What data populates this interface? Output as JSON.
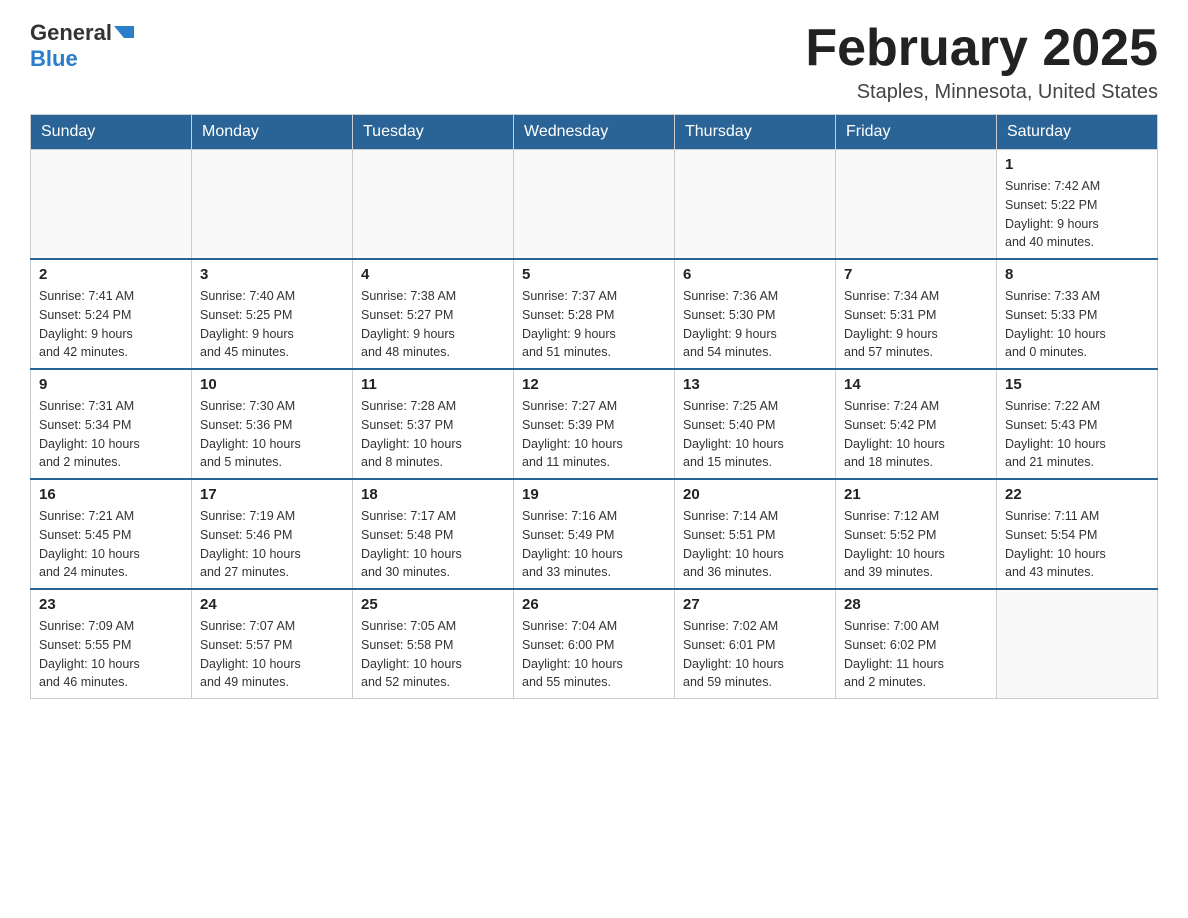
{
  "header": {
    "logo_general": "General",
    "logo_blue": "Blue",
    "title": "February 2025",
    "location": "Staples, Minnesota, United States"
  },
  "days_of_week": [
    "Sunday",
    "Monday",
    "Tuesday",
    "Wednesday",
    "Thursday",
    "Friday",
    "Saturday"
  ],
  "weeks": [
    [
      {
        "day": "",
        "info": ""
      },
      {
        "day": "",
        "info": ""
      },
      {
        "day": "",
        "info": ""
      },
      {
        "day": "",
        "info": ""
      },
      {
        "day": "",
        "info": ""
      },
      {
        "day": "",
        "info": ""
      },
      {
        "day": "1",
        "info": "Sunrise: 7:42 AM\nSunset: 5:22 PM\nDaylight: 9 hours\nand 40 minutes."
      }
    ],
    [
      {
        "day": "2",
        "info": "Sunrise: 7:41 AM\nSunset: 5:24 PM\nDaylight: 9 hours\nand 42 minutes."
      },
      {
        "day": "3",
        "info": "Sunrise: 7:40 AM\nSunset: 5:25 PM\nDaylight: 9 hours\nand 45 minutes."
      },
      {
        "day": "4",
        "info": "Sunrise: 7:38 AM\nSunset: 5:27 PM\nDaylight: 9 hours\nand 48 minutes."
      },
      {
        "day": "5",
        "info": "Sunrise: 7:37 AM\nSunset: 5:28 PM\nDaylight: 9 hours\nand 51 minutes."
      },
      {
        "day": "6",
        "info": "Sunrise: 7:36 AM\nSunset: 5:30 PM\nDaylight: 9 hours\nand 54 minutes."
      },
      {
        "day": "7",
        "info": "Sunrise: 7:34 AM\nSunset: 5:31 PM\nDaylight: 9 hours\nand 57 minutes."
      },
      {
        "day": "8",
        "info": "Sunrise: 7:33 AM\nSunset: 5:33 PM\nDaylight: 10 hours\nand 0 minutes."
      }
    ],
    [
      {
        "day": "9",
        "info": "Sunrise: 7:31 AM\nSunset: 5:34 PM\nDaylight: 10 hours\nand 2 minutes."
      },
      {
        "day": "10",
        "info": "Sunrise: 7:30 AM\nSunset: 5:36 PM\nDaylight: 10 hours\nand 5 minutes."
      },
      {
        "day": "11",
        "info": "Sunrise: 7:28 AM\nSunset: 5:37 PM\nDaylight: 10 hours\nand 8 minutes."
      },
      {
        "day": "12",
        "info": "Sunrise: 7:27 AM\nSunset: 5:39 PM\nDaylight: 10 hours\nand 11 minutes."
      },
      {
        "day": "13",
        "info": "Sunrise: 7:25 AM\nSunset: 5:40 PM\nDaylight: 10 hours\nand 15 minutes."
      },
      {
        "day": "14",
        "info": "Sunrise: 7:24 AM\nSunset: 5:42 PM\nDaylight: 10 hours\nand 18 minutes."
      },
      {
        "day": "15",
        "info": "Sunrise: 7:22 AM\nSunset: 5:43 PM\nDaylight: 10 hours\nand 21 minutes."
      }
    ],
    [
      {
        "day": "16",
        "info": "Sunrise: 7:21 AM\nSunset: 5:45 PM\nDaylight: 10 hours\nand 24 minutes."
      },
      {
        "day": "17",
        "info": "Sunrise: 7:19 AM\nSunset: 5:46 PM\nDaylight: 10 hours\nand 27 minutes."
      },
      {
        "day": "18",
        "info": "Sunrise: 7:17 AM\nSunset: 5:48 PM\nDaylight: 10 hours\nand 30 minutes."
      },
      {
        "day": "19",
        "info": "Sunrise: 7:16 AM\nSunset: 5:49 PM\nDaylight: 10 hours\nand 33 minutes."
      },
      {
        "day": "20",
        "info": "Sunrise: 7:14 AM\nSunset: 5:51 PM\nDaylight: 10 hours\nand 36 minutes."
      },
      {
        "day": "21",
        "info": "Sunrise: 7:12 AM\nSunset: 5:52 PM\nDaylight: 10 hours\nand 39 minutes."
      },
      {
        "day": "22",
        "info": "Sunrise: 7:11 AM\nSunset: 5:54 PM\nDaylight: 10 hours\nand 43 minutes."
      }
    ],
    [
      {
        "day": "23",
        "info": "Sunrise: 7:09 AM\nSunset: 5:55 PM\nDaylight: 10 hours\nand 46 minutes."
      },
      {
        "day": "24",
        "info": "Sunrise: 7:07 AM\nSunset: 5:57 PM\nDaylight: 10 hours\nand 49 minutes."
      },
      {
        "day": "25",
        "info": "Sunrise: 7:05 AM\nSunset: 5:58 PM\nDaylight: 10 hours\nand 52 minutes."
      },
      {
        "day": "26",
        "info": "Sunrise: 7:04 AM\nSunset: 6:00 PM\nDaylight: 10 hours\nand 55 minutes."
      },
      {
        "day": "27",
        "info": "Sunrise: 7:02 AM\nSunset: 6:01 PM\nDaylight: 10 hours\nand 59 minutes."
      },
      {
        "day": "28",
        "info": "Sunrise: 7:00 AM\nSunset: 6:02 PM\nDaylight: 11 hours\nand 2 minutes."
      },
      {
        "day": "",
        "info": ""
      }
    ]
  ]
}
